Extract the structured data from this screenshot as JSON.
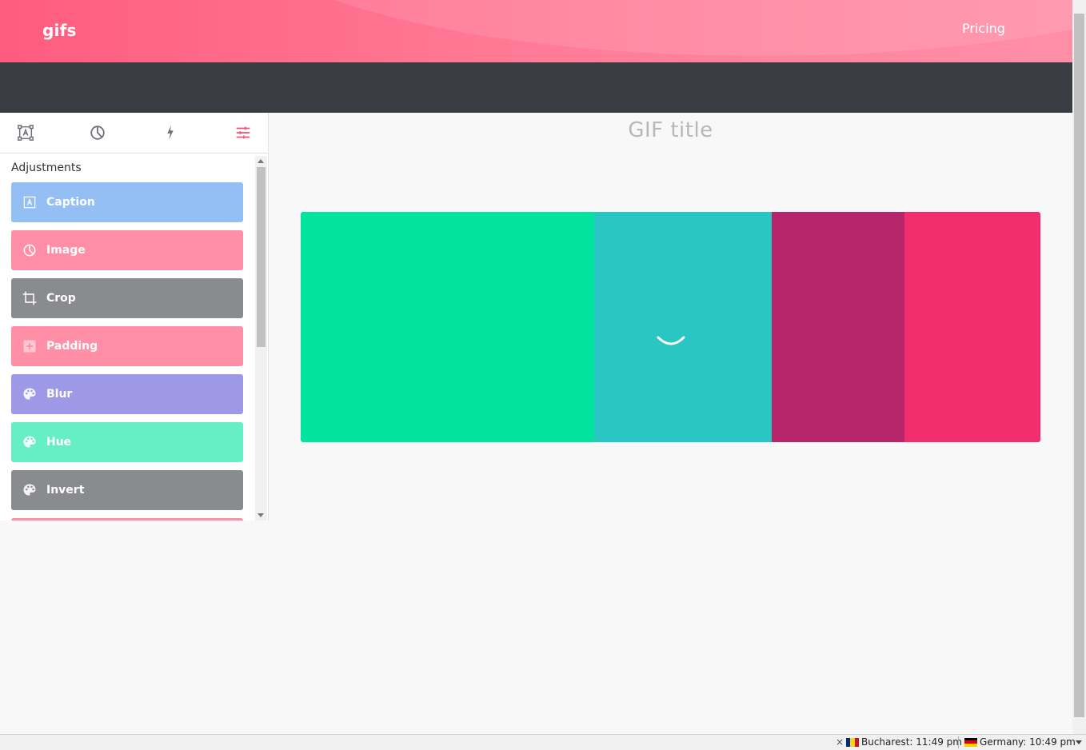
{
  "header": {
    "logo": "gifs",
    "nav_pricing": "Pricing"
  },
  "sidebar": {
    "section_title": "Adjustments",
    "active_tab": "adjustments",
    "items": [
      {
        "label": "Caption",
        "color": "#93bff5",
        "icon": "caption-icon"
      },
      {
        "label": "Image",
        "color": "#ff8fa7",
        "icon": "image-icon"
      },
      {
        "label": "Crop",
        "color": "#8a8b8f",
        "icon": "crop-icon"
      },
      {
        "label": "Padding",
        "color": "#ff8fa7",
        "icon": "padding-icon"
      },
      {
        "label": "Blur",
        "color": "#9d99e6",
        "icon": "palette-icon"
      },
      {
        "label": "Hue",
        "color": "#66efc5",
        "icon": "palette-icon"
      },
      {
        "label": "Invert",
        "color": "#8a8b8f",
        "icon": "palette-icon"
      }
    ]
  },
  "main": {
    "gif_title": "GIF title",
    "gif_colors": [
      "#02e39f",
      "#29c6c3",
      "#b5276a",
      "#f02e6d"
    ]
  },
  "statusbar": {
    "close": "×",
    "clock1": "Bucharest: 11:49 pm",
    "clock2": "Germany: 10:49 pm"
  }
}
